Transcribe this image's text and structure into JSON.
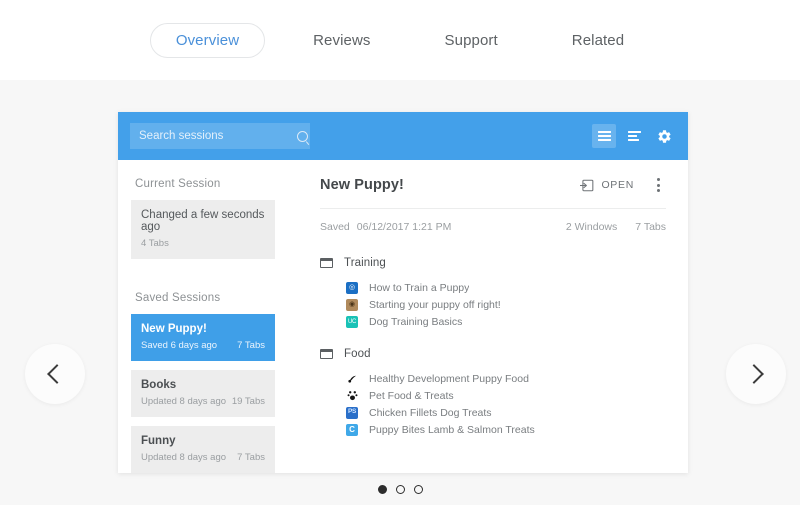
{
  "theme": {
    "accent_blue": "#43a0ea",
    "selected_blue": "#3f9fe8",
    "page_bg": "#f7f7f7",
    "card_bg": "#ededed"
  },
  "nav": {
    "tabs": [
      {
        "label": "Overview",
        "active": true
      },
      {
        "label": "Reviews",
        "active": false
      },
      {
        "label": "Support",
        "active": false
      },
      {
        "label": "Related",
        "active": false
      }
    ]
  },
  "carousel": {
    "prev_icon": "chevron-left-icon",
    "next_icon": "chevron-right-icon",
    "dots": [
      {
        "active": true
      },
      {
        "active": false
      },
      {
        "active": false
      }
    ]
  },
  "app": {
    "header": {
      "search": {
        "placeholder": "Search sessions",
        "value": "",
        "icon": "search-icon"
      },
      "actions": [
        {
          "name": "view-compact-icon",
          "active": true
        },
        {
          "name": "view-list-icon",
          "active": false
        },
        {
          "name": "gear-icon",
          "active": false
        }
      ]
    },
    "sidebar": {
      "current_session_label": "Current Session",
      "current_session": {
        "title": "Changed a few seconds ago",
        "tabs": "4 Tabs"
      },
      "saved_sessions_label": "Saved Sessions",
      "saved_sessions": [
        {
          "title": "New Puppy!",
          "subtitle": "Saved 6 days ago",
          "tabs": "7 Tabs",
          "selected": true
        },
        {
          "title": "Books",
          "subtitle": "Updated 8 days ago",
          "tabs": "19 Tabs",
          "selected": false
        },
        {
          "title": "Funny",
          "subtitle": "Updated 8 days ago",
          "tabs": "7 Tabs",
          "selected": false
        }
      ]
    },
    "detail": {
      "title": "New Puppy!",
      "open_label": "OPEN",
      "open_icon": "open-in-app-icon",
      "menu_icon": "kebab-menu-icon",
      "saved_word": "Saved",
      "saved_timestamp": "06/12/2017 1:21 PM",
      "windows_count": "2 Windows",
      "tabs_count": "7 Tabs",
      "groups": [
        {
          "name": "Training",
          "icon": "browser-window-icon",
          "tabs": [
            {
              "title": "How to Train a Puppy",
              "favicon": "blue-circle-favicon",
              "fav_bg": "#1b6fc4",
              "fav_fg": "#ffffff",
              "fav_text": "○"
            },
            {
              "title": "Starting your puppy off right!",
              "favicon": "brown-square-favicon",
              "fav_bg": "#a87b4c",
              "fav_fg": "#3b2a18",
              "fav_text": "◉"
            },
            {
              "title": "Dog Training Basics",
              "favicon": "teal-letters-favicon",
              "fav_bg": "#17c0b4",
              "fav_fg": "#ffffff",
              "fav_text": "UC"
            }
          ]
        },
        {
          "name": "Food",
          "icon": "browser-window-icon",
          "tabs": [
            {
              "title": "Healthy Development Puppy Food",
              "favicon": "black-paw-favicon",
              "fav_bg": "#ffffff",
              "fav_fg": "#1d1d1d",
              "fav_text": "◢"
            },
            {
              "title": "Pet Food & Treats",
              "favicon": "black-pet-favicon",
              "fav_bg": "#ffffff",
              "fav_fg": "#1d1d1d",
              "fav_text": "☘"
            },
            {
              "title": "Chicken Fillets Dog Treats",
              "favicon": "blue-ps-favicon",
              "fav_bg": "#2a6fc9",
              "fav_fg": "#ffffff",
              "fav_text": "PS"
            },
            {
              "title": "Puppy Bites Lamb & Salmon Treats",
              "favicon": "blue-c-favicon",
              "fav_bg": "#3fa8e8",
              "fav_fg": "#ffffff",
              "fav_text": "C"
            }
          ]
        }
      ]
    }
  }
}
